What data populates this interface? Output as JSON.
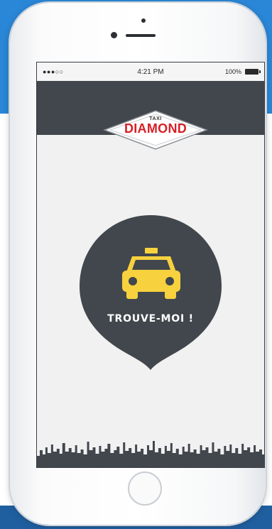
{
  "status_bar": {
    "signal": "●●●○○",
    "time": "4:21 PM",
    "battery": "100%"
  },
  "logo": {
    "small_text": "TAXI",
    "big_text": "DIAMOND"
  },
  "main": {
    "find_me_label": "TROUVE-MOI !"
  },
  "colors": {
    "header": "#42474d",
    "pin": "#41474c",
    "taxi": "#f7d23e",
    "brand_red": "#d72027",
    "background_blue": "#2a86d6"
  },
  "icons": {
    "taxi": "taxi-icon",
    "pin": "location-pin-icon",
    "battery": "battery-icon"
  }
}
